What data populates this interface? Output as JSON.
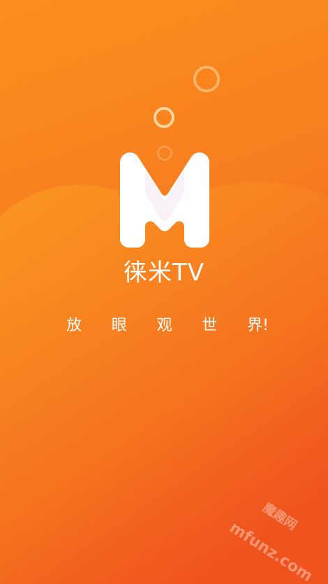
{
  "splash": {
    "app_name": "徕米TV",
    "slogan_chars": [
      "放",
      "眼",
      "观",
      "世",
      "界!"
    ]
  },
  "watermark": {
    "site": "mfunz.com",
    "brand": "魔趣网"
  },
  "colors": {
    "gradient_start": "#fb8e1e",
    "gradient_end": "#ee4a1c",
    "logo": "#ffffff"
  }
}
